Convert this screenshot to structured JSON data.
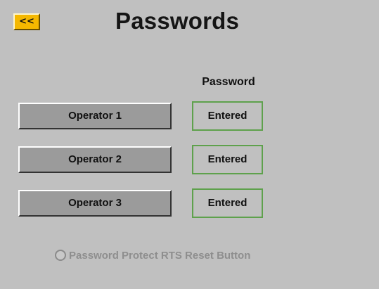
{
  "header": {
    "back_label": "<<",
    "title": "Passwords"
  },
  "table": {
    "column_header": "Password",
    "rows": [
      {
        "operator_label": "Operator 1",
        "status": "Entered"
      },
      {
        "operator_label": "Operator 2",
        "status": "Entered"
      },
      {
        "operator_label": "Operator 3",
        "status": "Entered"
      }
    ]
  },
  "options": {
    "protect_reset_label": "Password Protect RTS Reset Button",
    "protect_reset_selected": false
  },
  "colors": {
    "back_button": "#f5b800",
    "status_border": "#5ea14c",
    "background": "#c0c0c0",
    "disabled_text": "#8e8e8e"
  },
  "icons": {
    "radio": "radio-unchecked-icon"
  }
}
